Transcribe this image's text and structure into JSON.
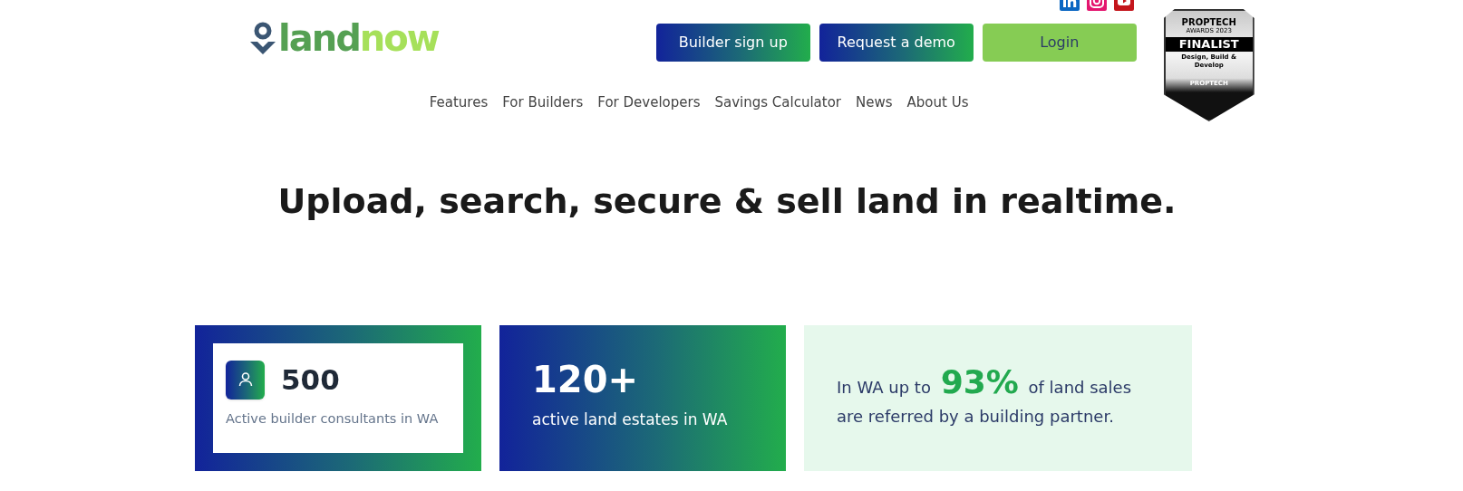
{
  "header": {
    "logo": {
      "parts": [
        "land",
        "now"
      ]
    },
    "buttons": [
      {
        "label": "Builder sign up",
        "kind": "gradient"
      },
      {
        "label": "Request a demo",
        "kind": "gradient"
      },
      {
        "label": "Login",
        "kind": "solid"
      }
    ],
    "nav": [
      "Features",
      "For Builders",
      "For Developers",
      "Savings Calculator",
      "News",
      "About Us"
    ],
    "badge": {
      "title": "PROPTECH",
      "subtitle": "AWARDS 2023",
      "ribbon": "FINALIST",
      "category": "Design, Build & Develop",
      "footer": "PROPTECH"
    }
  },
  "hero": {
    "heading": "Upload, search, secure & sell land in realtime."
  },
  "stats": [
    {
      "kind": "framed",
      "value": "500",
      "caption": "Active builder consultants in WA"
    },
    {
      "kind": "gradient",
      "value": "120+",
      "caption": "active land estates in WA"
    },
    {
      "kind": "text",
      "text": "In WA up to **93%** of land sales are referred by a building partner."
    }
  ]
}
